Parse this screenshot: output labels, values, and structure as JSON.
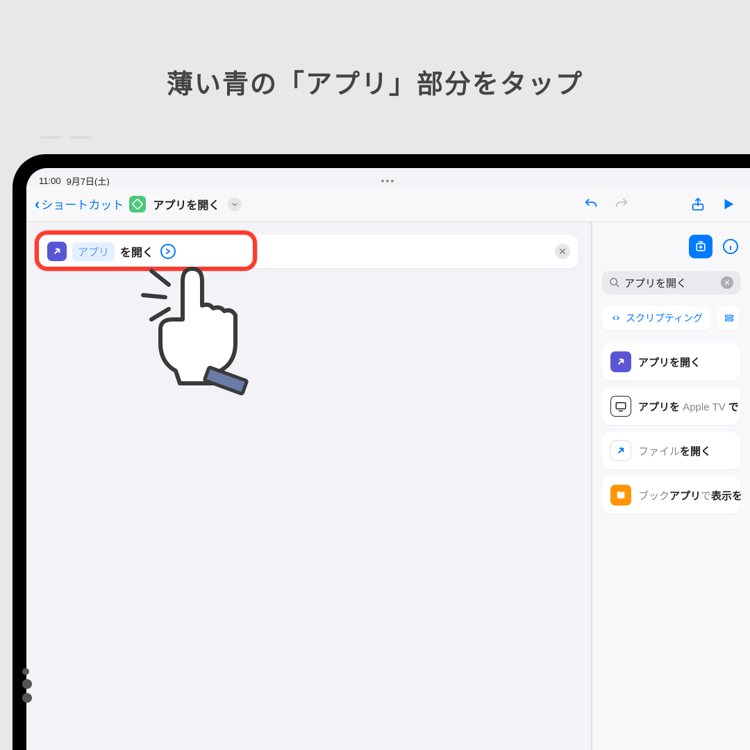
{
  "caption": "薄い青の「アプリ」部分をタップ",
  "status": {
    "time": "11:00",
    "date": "9月7日(土)"
  },
  "toolbar": {
    "back_label": "ショートカット",
    "title": "アプリを開く"
  },
  "action": {
    "token": "アプリ",
    "suffix": "を開く"
  },
  "search": {
    "value": "アプリを開く"
  },
  "chips": {
    "scripting": "スクリプティング"
  },
  "results": {
    "r1_bold": "アプリを開く",
    "r2_pre": "アプリを",
    "r2_light": " Apple TV ",
    "r2_post": "で",
    "r3_light": "ファイル",
    "r3_bold": "を開く",
    "r4_light": "ブック",
    "r4_bold1": "アプリ",
    "r4_mid": "で",
    "r4_bold2": "表示を"
  }
}
